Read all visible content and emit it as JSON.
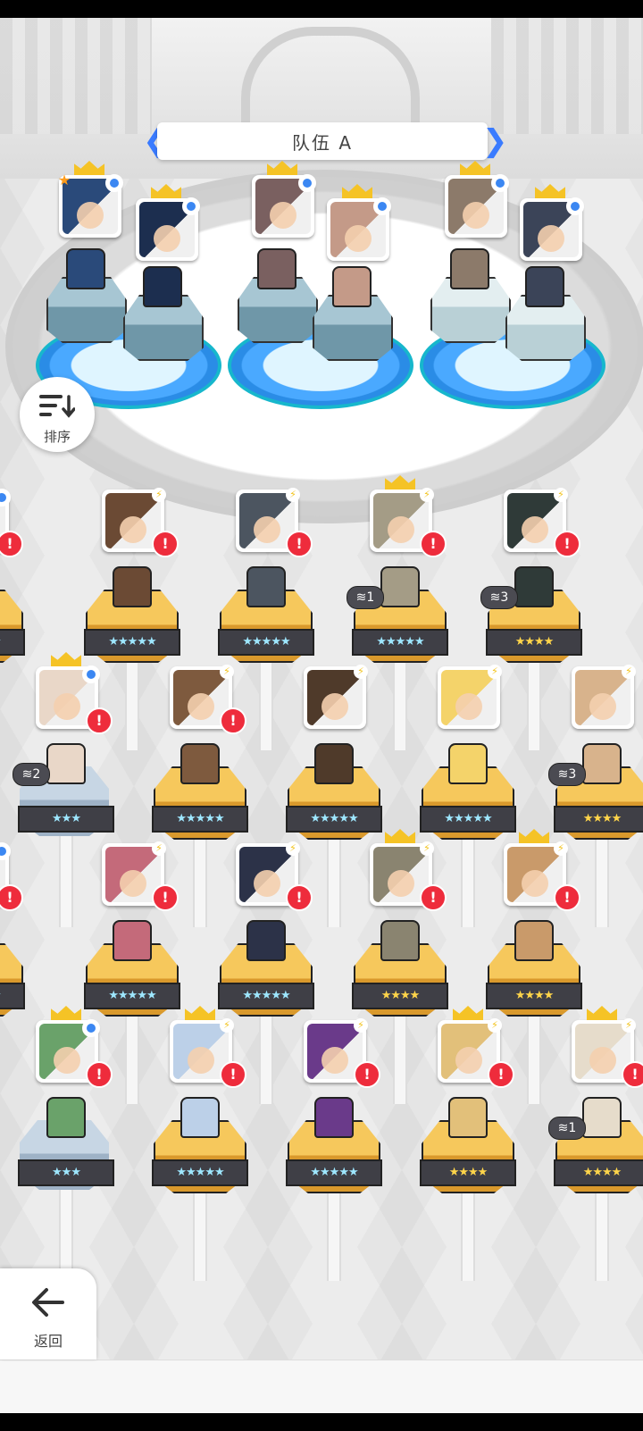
{
  "team": {
    "title": "队伍 A"
  },
  "controls": {
    "sort_label": "排序",
    "back_label": "返回"
  },
  "team_members": [
    {
      "name": "black-hair-girl",
      "frame": "star",
      "crown": true,
      "color": "#2a4a7a"
    },
    {
      "name": "armored-knight",
      "frame": "blue",
      "crown": true,
      "color": "#1c2e4f"
    },
    {
      "name": "white-hair-dark",
      "frame": "blue",
      "crown": true,
      "color": "#7a6060"
    },
    {
      "name": "brown-hair-girl",
      "frame": "blue",
      "crown": true,
      "color": "#c49a88"
    },
    {
      "name": "grey-hair-warrior",
      "frame": "blue",
      "crown": true,
      "color": "#8c7a6a"
    },
    {
      "name": "silver-hair-girl",
      "frame": "blue",
      "crown": true,
      "color": "#3b4458"
    }
  ],
  "roster": [
    {
      "row": 0,
      "col": 0,
      "frame": "blue",
      "alert": "!",
      "stars": "★★★★★",
      "star_color": "cyan",
      "color": "#9b6c4b"
    },
    {
      "row": 0,
      "col": 1,
      "frame": "bolt",
      "alert": "!",
      "stars": "★★★★★",
      "star_color": "cyan",
      "color": "#6b4a34"
    },
    {
      "row": 0,
      "col": 2,
      "frame": "bolt",
      "alert": "!",
      "stars": "★★★★★",
      "star_color": "cyan",
      "color": "#4c5560"
    },
    {
      "row": 0,
      "col": 3,
      "frame": "bolt",
      "crown": true,
      "alert": "!",
      "chip": "1",
      "stars": "★★★★★",
      "star_color": "cyan",
      "color": "#a49c86"
    },
    {
      "row": 0,
      "col": 4,
      "frame": "bolt",
      "alert": "!",
      "chip": "3",
      "stars": "★★★★",
      "star_color": "gold",
      "color": "#2f3a38"
    },
    {
      "row": 1,
      "col": 0,
      "frame": "blue",
      "crown": true,
      "alert": "!",
      "chip": "2",
      "stars": "★★★",
      "star_color": "cyan",
      "color": "#e9d7c8"
    },
    {
      "row": 1,
      "col": 1,
      "frame": "bolt",
      "alert": "!",
      "stars": "★★★★★",
      "star_color": "cyan",
      "color": "#7e5a3e"
    },
    {
      "row": 1,
      "col": 2,
      "frame": "bolt",
      "stars": "★★★★★",
      "star_color": "cyan",
      "color": "#4f3a2a"
    },
    {
      "row": 1,
      "col": 3,
      "frame": "bolt",
      "stars": "★★★★★",
      "star_color": "cyan",
      "color": "#f4d36a"
    },
    {
      "row": 1,
      "col": 4,
      "frame": "bolt",
      "chip": "3",
      "stars": "★★★★",
      "star_color": "gold",
      "color": "#d8b38c"
    },
    {
      "row": 2,
      "col": 0,
      "frame": "blue",
      "alert": "!",
      "stars": "★★★★★",
      "star_color": "cyan",
      "color": "#7d5b3f"
    },
    {
      "row": 2,
      "col": 1,
      "frame": "bolt",
      "alert": "!",
      "stars": "★★★★★",
      "star_color": "cyan",
      "color": "#c46a7a"
    },
    {
      "row": 2,
      "col": 2,
      "frame": "bolt",
      "alert": "!",
      "stars": "★★★★★",
      "star_color": "cyan",
      "color": "#2c3248"
    },
    {
      "row": 2,
      "col": 3,
      "frame": "bolt",
      "crown": true,
      "alert": "!",
      "stars": "★★★★",
      "star_color": "gold",
      "color": "#8a8470"
    },
    {
      "row": 2,
      "col": 4,
      "frame": "bolt",
      "crown": true,
      "alert": "!",
      "stars": "★★★★",
      "star_color": "gold",
      "color": "#c99a6a"
    },
    {
      "row": 3,
      "col": 0,
      "frame": "blue",
      "crown": true,
      "alert": "!",
      "stars": "★★★",
      "star_color": "cyan",
      "color": "#6aa26a"
    },
    {
      "row": 3,
      "col": 1,
      "frame": "bolt",
      "crown": true,
      "alert": "!",
      "stars": "★★★★★",
      "star_color": "cyan",
      "color": "#bcd0e8"
    },
    {
      "row": 3,
      "col": 2,
      "frame": "bolt",
      "alert": "!",
      "stars": "★★★★★",
      "star_color": "cyan",
      "color": "#6a3a8a"
    },
    {
      "row": 3,
      "col": 3,
      "frame": "bolt",
      "crown": true,
      "alert": "!",
      "stars": "★★★★",
      "star_color": "gold",
      "color": "#e2c07a"
    },
    {
      "row": 3,
      "col": 4,
      "frame": "bolt",
      "crown": true,
      "alert": "!",
      "chip": "1",
      "stars": "★★★★",
      "star_color": "gold",
      "color": "#e6dccb"
    }
  ]
}
